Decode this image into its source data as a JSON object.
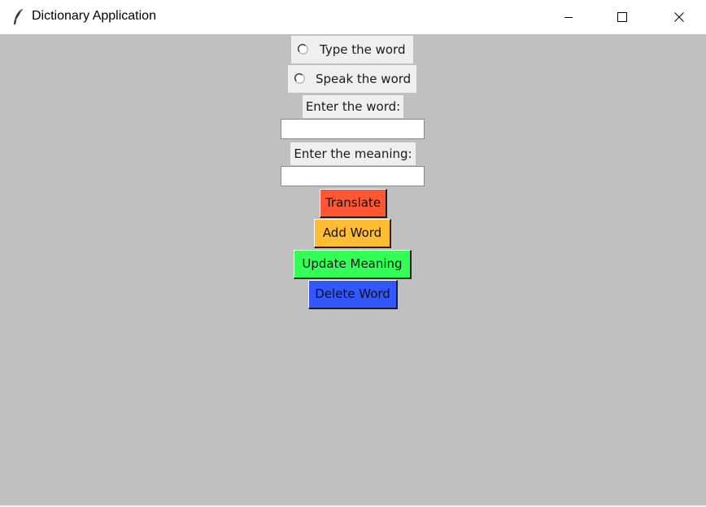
{
  "window": {
    "title": "Dictionary Application",
    "icon": "feather-icon",
    "controls": {
      "minimize_icon": "minimize-icon",
      "maximize_icon": "maximize-icon",
      "close_icon": "close-icon"
    }
  },
  "mode": {
    "options": [
      {
        "label": "Type the word",
        "selected": false
      },
      {
        "label": "Speak the word",
        "selected": false
      }
    ]
  },
  "word_field": {
    "label": "Enter the word:",
    "value": "",
    "placeholder": ""
  },
  "meaning_field": {
    "label": "Enter the meaning:",
    "value": "",
    "placeholder": ""
  },
  "buttons": {
    "translate": {
      "label": "Translate",
      "color": "#ff5733"
    },
    "add_word": {
      "label": "Add Word",
      "color": "#ffbd33"
    },
    "update_meaning": {
      "label": "Update Meaning",
      "color": "#33ff57"
    },
    "delete_word": {
      "label": "Delete Word",
      "color": "#3357ff"
    }
  },
  "colors": {
    "background": "#c0c0c0",
    "widget_background": "#efefef"
  }
}
